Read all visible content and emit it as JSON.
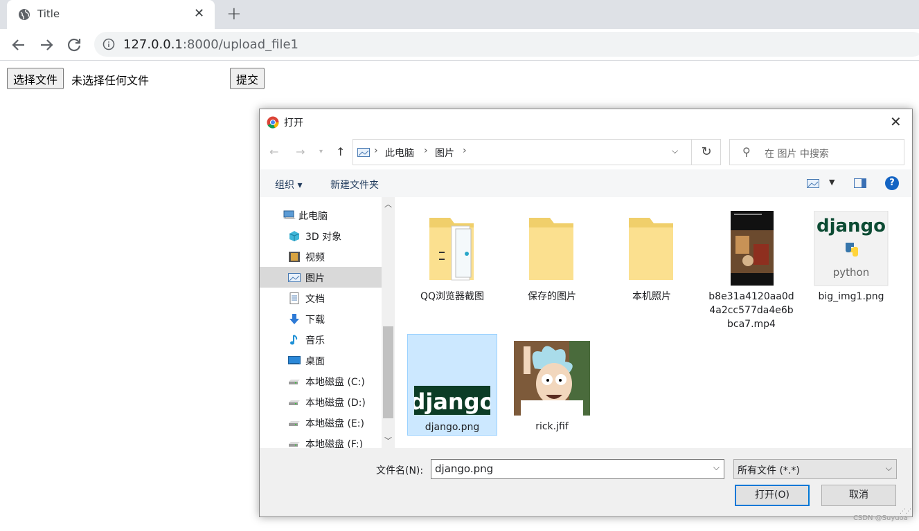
{
  "browser": {
    "tab_title": "Title",
    "tab_close": "✕",
    "new_tab": "+",
    "url_host": "127.0.0.1",
    "url_rest": ":8000/upload_file1"
  },
  "page": {
    "choose_file_label": "选择文件",
    "no_file_text": "未选择任何文件",
    "submit_label": "提交"
  },
  "dialog": {
    "title": "打开",
    "breadcrumb": [
      "此电脑",
      "图片"
    ],
    "search_placeholder": "在 图片 中搜索",
    "organize_label": "组织 ▾",
    "new_folder_label": "新建文件夹",
    "help_label": "?",
    "nav_items": [
      {
        "label": "此电脑",
        "icon": "computer-icon"
      },
      {
        "label": "3D 对象",
        "icon": "3d-objects-icon"
      },
      {
        "label": "视频",
        "icon": "video-icon"
      },
      {
        "label": "图片",
        "icon": "pictures-icon",
        "selected": true
      },
      {
        "label": "文档",
        "icon": "documents-icon"
      },
      {
        "label": "下载",
        "icon": "download-icon"
      },
      {
        "label": "音乐",
        "icon": "music-icon"
      },
      {
        "label": "桌面",
        "icon": "desktop-icon"
      },
      {
        "label": "本地磁盘 (C:)",
        "icon": "drive-icon"
      },
      {
        "label": "本地磁盘 (D:)",
        "icon": "drive-icon"
      },
      {
        "label": "本地磁盘 (E:)",
        "icon": "drive-icon"
      },
      {
        "label": "本地磁盘 (F:)",
        "icon": "drive-icon"
      }
    ],
    "files": [
      {
        "name": "QQ浏览器截图",
        "kind": "folder"
      },
      {
        "name": "保存的图片",
        "kind": "folder"
      },
      {
        "name": "本机照片",
        "kind": "folder"
      },
      {
        "name": "b8e31a4120aa0d4a2cc577da4e6bbca7.mp4",
        "kind": "video"
      },
      {
        "name": "big_img1.png",
        "kind": "image"
      },
      {
        "name": "django.png",
        "kind": "image",
        "selected": true
      },
      {
        "name": "rick.jfif",
        "kind": "image"
      }
    ],
    "thumb_text": {
      "django": "django",
      "python": "python"
    },
    "filename_label": "文件名(N):",
    "filename_value": "django.png",
    "filetype_value": "所有文件 (*.*)",
    "open_label": "打开(O)",
    "cancel_label": "取消"
  },
  "watermark": "CSDN @Suyuoa"
}
